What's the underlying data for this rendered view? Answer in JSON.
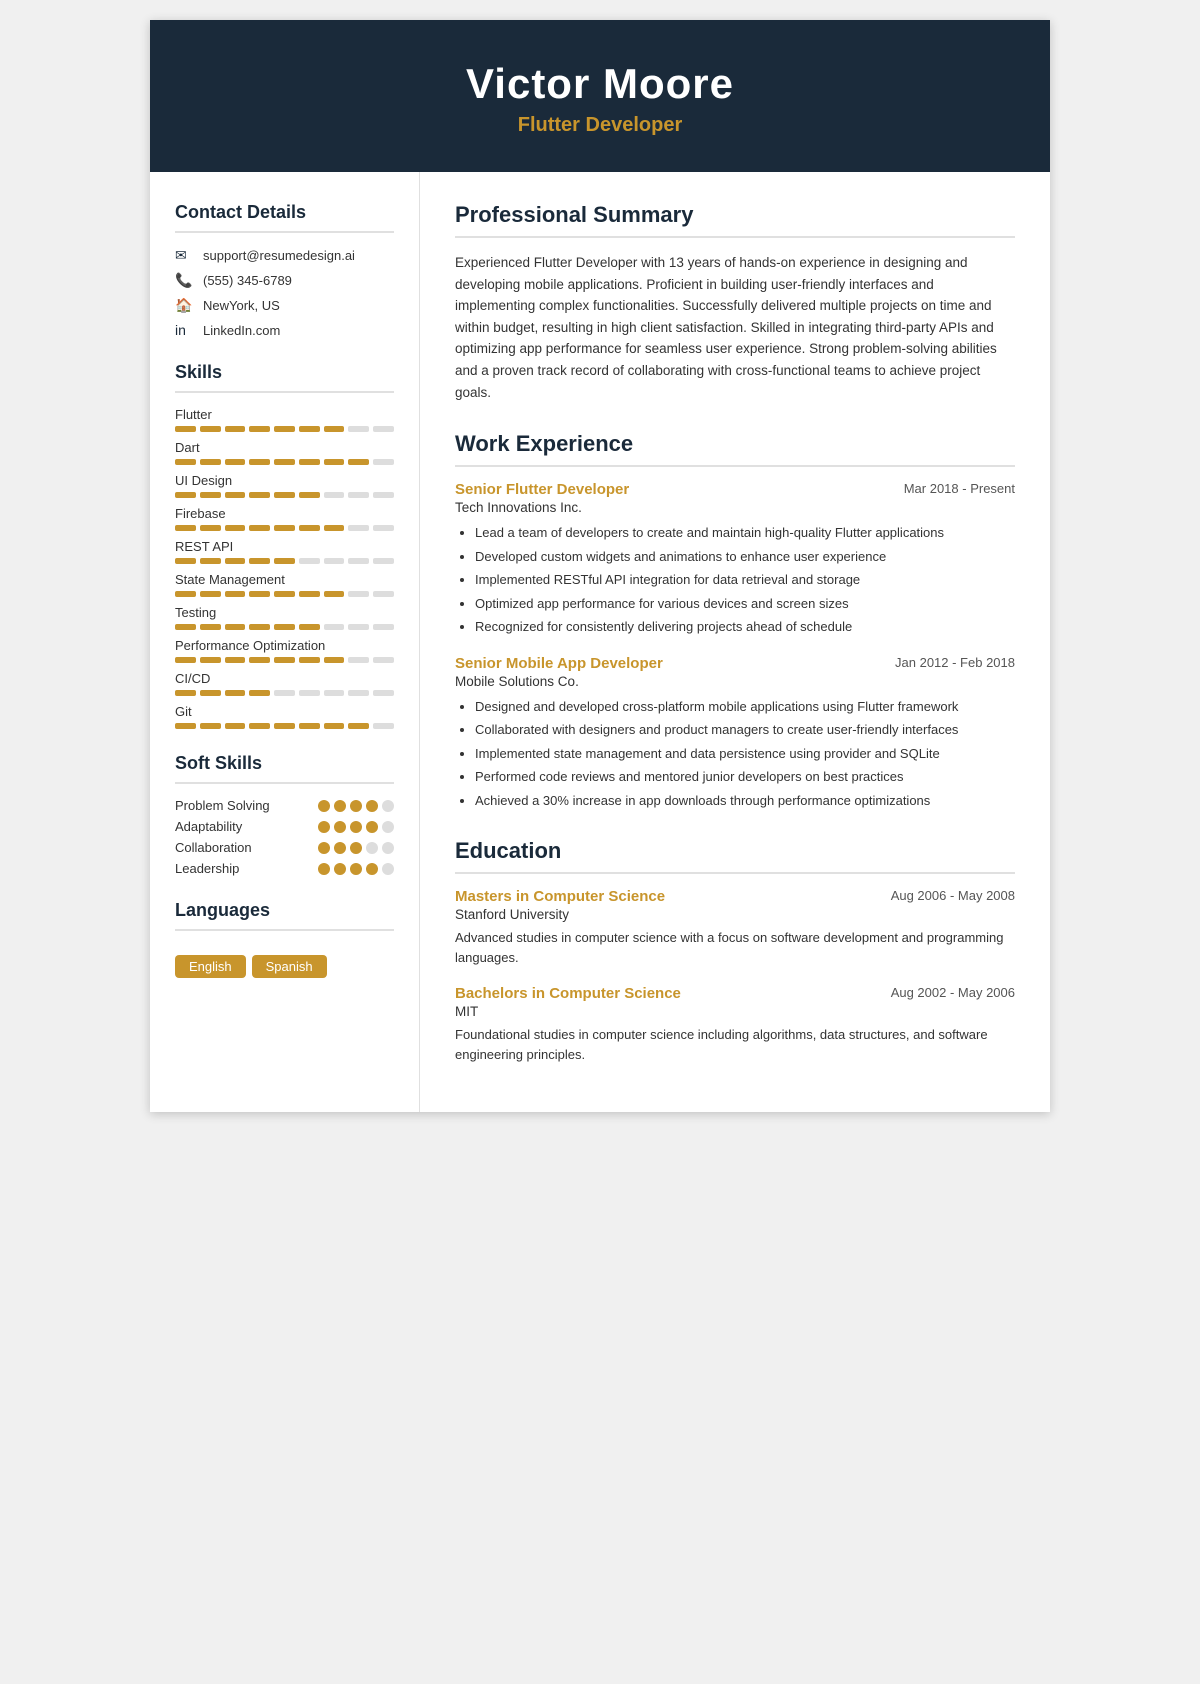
{
  "header": {
    "name": "Victor Moore",
    "title": "Flutter Developer"
  },
  "sidebar": {
    "contact_section": "Contact Details",
    "contact": {
      "email": "support@resumedesign.ai",
      "phone": "(555) 345-6789",
      "location": "NewYork, US",
      "linkedin": "LinkedIn.com"
    },
    "skills_section": "Skills",
    "skills": [
      {
        "name": "Flutter",
        "filled": 7,
        "total": 9
      },
      {
        "name": "Dart",
        "filled": 8,
        "total": 9
      },
      {
        "name": "UI Design",
        "filled": 6,
        "total": 9
      },
      {
        "name": "Firebase",
        "filled": 7,
        "total": 9
      },
      {
        "name": "REST API",
        "filled": 5,
        "total": 9
      },
      {
        "name": "State Management",
        "filled": 7,
        "total": 9
      },
      {
        "name": "Testing",
        "filled": 6,
        "total": 9
      },
      {
        "name": "Performance Optimization",
        "filled": 7,
        "total": 9
      },
      {
        "name": "CI/CD",
        "filled": 4,
        "total": 9
      },
      {
        "name": "Git",
        "filled": 8,
        "total": 9
      }
    ],
    "soft_skills_section": "Soft Skills",
    "soft_skills": [
      {
        "name": "Problem Solving",
        "filled": 4,
        "total": 5
      },
      {
        "name": "Adaptability",
        "filled": 4,
        "total": 5
      },
      {
        "name": "Collaboration",
        "filled": 3,
        "total": 5
      },
      {
        "name": "Leadership",
        "filled": 4,
        "total": 5
      }
    ],
    "languages_section": "Languages",
    "languages": [
      "English",
      "Spanish"
    ]
  },
  "main": {
    "summary_section": "Professional Summary",
    "summary": "Experienced Flutter Developer with 13 years of hands-on experience in designing and developing mobile applications. Proficient in building user-friendly interfaces and implementing complex functionalities. Successfully delivered multiple projects on time and within budget, resulting in high client satisfaction. Skilled in integrating third-party APIs and optimizing app performance for seamless user experience. Strong problem-solving abilities and a proven track record of collaborating with cross-functional teams to achieve project goals.",
    "work_section": "Work Experience",
    "jobs": [
      {
        "title": "Senior Flutter Developer",
        "dates": "Mar 2018 - Present",
        "company": "Tech Innovations Inc.",
        "bullets": [
          "Lead a team of developers to create and maintain high-quality Flutter applications",
          "Developed custom widgets and animations to enhance user experience",
          "Implemented RESTful API integration for data retrieval and storage",
          "Optimized app performance for various devices and screen sizes",
          "Recognized for consistently delivering projects ahead of schedule"
        ]
      },
      {
        "title": "Senior Mobile App Developer",
        "dates": "Jan 2012 - Feb 2018",
        "company": "Mobile Solutions Co.",
        "bullets": [
          "Designed and developed cross-platform mobile applications using Flutter framework",
          "Collaborated with designers and product managers to create user-friendly interfaces",
          "Implemented state management and data persistence using provider and SQLite",
          "Performed code reviews and mentored junior developers on best practices",
          "Achieved a 30% increase in app downloads through performance optimizations"
        ]
      }
    ],
    "education_section": "Education",
    "education": [
      {
        "degree": "Masters in Computer Science",
        "dates": "Aug 2006 - May 2008",
        "school": "Stanford University",
        "description": "Advanced studies in computer science with a focus on software development and programming languages."
      },
      {
        "degree": "Bachelors in Computer Science",
        "dates": "Aug 2002 - May 2006",
        "school": "MIT",
        "description": "Foundational studies in computer science including algorithms, data structures, and software engineering principles."
      }
    ]
  }
}
